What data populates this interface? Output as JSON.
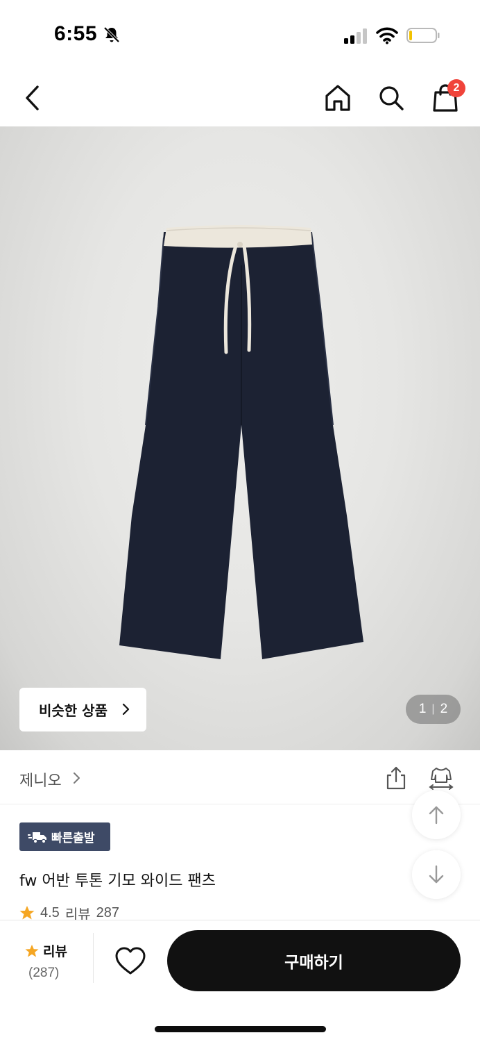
{
  "status_bar": {
    "time": "6:55",
    "icons": [
      "bell-off-icon",
      "signal-icon",
      "wifi-icon",
      "battery-icon"
    ]
  },
  "nav": {
    "icons": [
      "back-icon",
      "home-icon",
      "search-icon",
      "shopping-bag-icon"
    ],
    "cart_badge": "2"
  },
  "gallery": {
    "similar_button_label": "비슷한 상품",
    "current_page": "1",
    "separator": "|",
    "total_pages": "2"
  },
  "brand": {
    "name": "제니오",
    "icons": [
      "chevron-right-icon",
      "share-icon",
      "size-fit-icon"
    ]
  },
  "product": {
    "badge_label": "빠른출발",
    "title": "fw 어반 투톤 기모 와이드 팬츠",
    "rating": "4.5",
    "review_label": "리뷰",
    "review_count": "287"
  },
  "bottom_bar": {
    "review_label": "리뷰",
    "review_count": "(287)",
    "buy_label": "구매하기",
    "icons": [
      "star-icon",
      "heart-icon"
    ]
  },
  "colors": {
    "accent_badge": "#f0433a",
    "fast_badge_bg": "#3e4a66",
    "star": "#f5a623",
    "buy_button_bg": "#111111",
    "pants_navy": "#1c2233",
    "waistband_cream": "#ece7dc"
  }
}
